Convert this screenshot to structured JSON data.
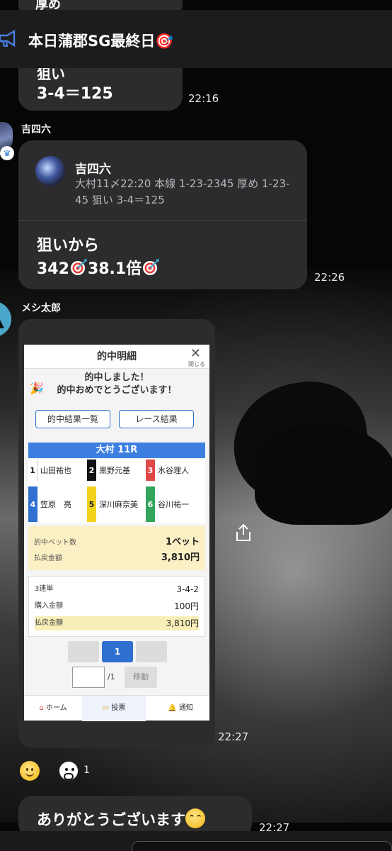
{
  "pinned": {
    "title": "本日蒲郡SG最終日🎯"
  },
  "top_fragment": "厚め",
  "messages": [
    {
      "lines": [
        "狙い",
        "3-4＝125"
      ],
      "time": "22:16"
    },
    {
      "sender": "吉四六",
      "quote": {
        "name": "吉四六",
        "text": "大村11〆22:20 本線 1-23-2345 厚め 1-23-45 狙い 3-4＝125"
      },
      "body_line1": "狙いから",
      "body_line2_a": "342",
      "body_line2_b": "38.1倍",
      "time": "22:26"
    },
    {
      "sender": "メシ太郎",
      "time": "22:27",
      "screenshot": {
        "header_title": "的中明細",
        "close_label": "閉じる",
        "congrats": "的中しました！",
        "congrats2": "的中おめでとうございます！",
        "btn_list": "的中結果一覧",
        "btn_result": "レース結果",
        "race": "大村 11R",
        "racers": [
          {
            "num": "1",
            "name": "山田祐也"
          },
          {
            "num": "2",
            "name": "黒野元基"
          },
          {
            "num": "3",
            "name": "水谷理人"
          },
          {
            "num": "4",
            "name": "笠原　亮"
          },
          {
            "num": "5",
            "name": "深川麻奈美"
          },
          {
            "num": "6",
            "name": "谷川祐一"
          }
        ],
        "bet_count_label": "的中ベット数",
        "bet_count_value": "1ベット",
        "payout_label": "払戻金額",
        "payout_value": "3,810円",
        "detail": [
          {
            "label": "3連単",
            "value": "3-4-2"
          },
          {
            "label": "購入金額",
            "value": "100円"
          },
          {
            "label": "払戻金額",
            "value": "3,810円"
          }
        ],
        "page_current": "1",
        "page_total": "/1",
        "page_btn": "移動",
        "tabs": [
          "ホーム",
          "投票",
          "通知"
        ]
      }
    },
    {
      "text": "ありがとうございます",
      "time": "22:27"
    }
  ],
  "reactions": {
    "count": "1"
  },
  "colors": {
    "bubble": "#2c2c2e",
    "header": "#1c1c1e",
    "race_bar": "#3d7fe0"
  }
}
